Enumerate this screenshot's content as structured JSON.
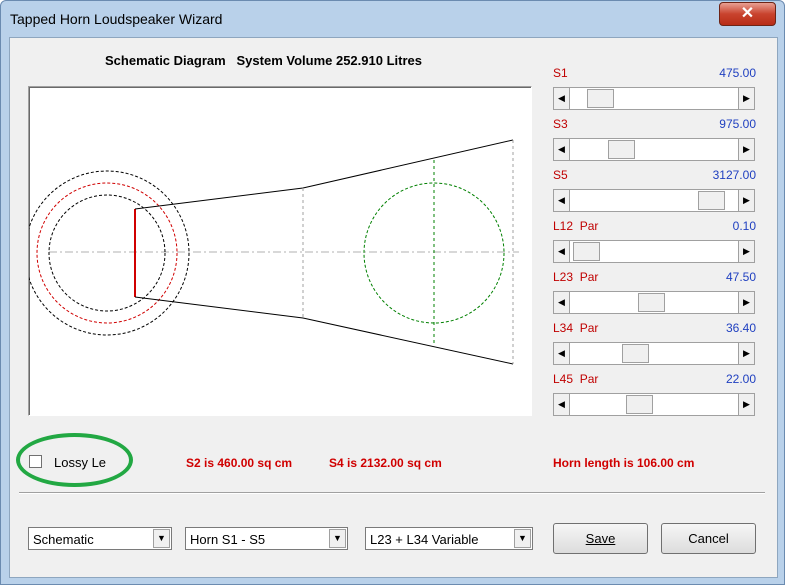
{
  "window": {
    "title": "Tapped Horn Loudspeaker Wizard",
    "close_glyph": "✕"
  },
  "heading": {
    "diagram_label": "Schematic Diagram",
    "volume_text": "System Volume 252.910 Litres"
  },
  "sliders": [
    {
      "label": "S1",
      "value": "475.00",
      "position": 0.12
    },
    {
      "label": "S3",
      "value": "975.00",
      "position": 0.27
    },
    {
      "label": "S5",
      "value": "3127.00",
      "position": 0.91
    },
    {
      "label": "L12  Par",
      "value": "0.10",
      "position": 0.02
    },
    {
      "label": "L23  Par",
      "value": "47.50",
      "position": 0.48
    },
    {
      "label": "L34  Par",
      "value": "36.40",
      "position": 0.37
    },
    {
      "label": "L45  Par",
      "value": "22.00",
      "position": 0.4
    }
  ],
  "arrows": {
    "left": "◀",
    "right": "▶",
    "down": "▼"
  },
  "lossy": {
    "label": "Lossy Le",
    "checked": false
  },
  "info": {
    "s2": "S2 is 460.00 sq cm",
    "s4": "S4 is 2132.00 sq cm",
    "horn_length": "Horn length is 106.00 cm"
  },
  "bottom": {
    "view_select": "Schematic",
    "horn_select": "Horn S1 - S5",
    "variable_select": "L23 + L34 Variable",
    "save_label": "Save",
    "cancel_label": "Cancel"
  },
  "colors": {
    "label_red": "#c00000",
    "value_blue": "#2040c0",
    "highlight_green": "#22a843"
  }
}
